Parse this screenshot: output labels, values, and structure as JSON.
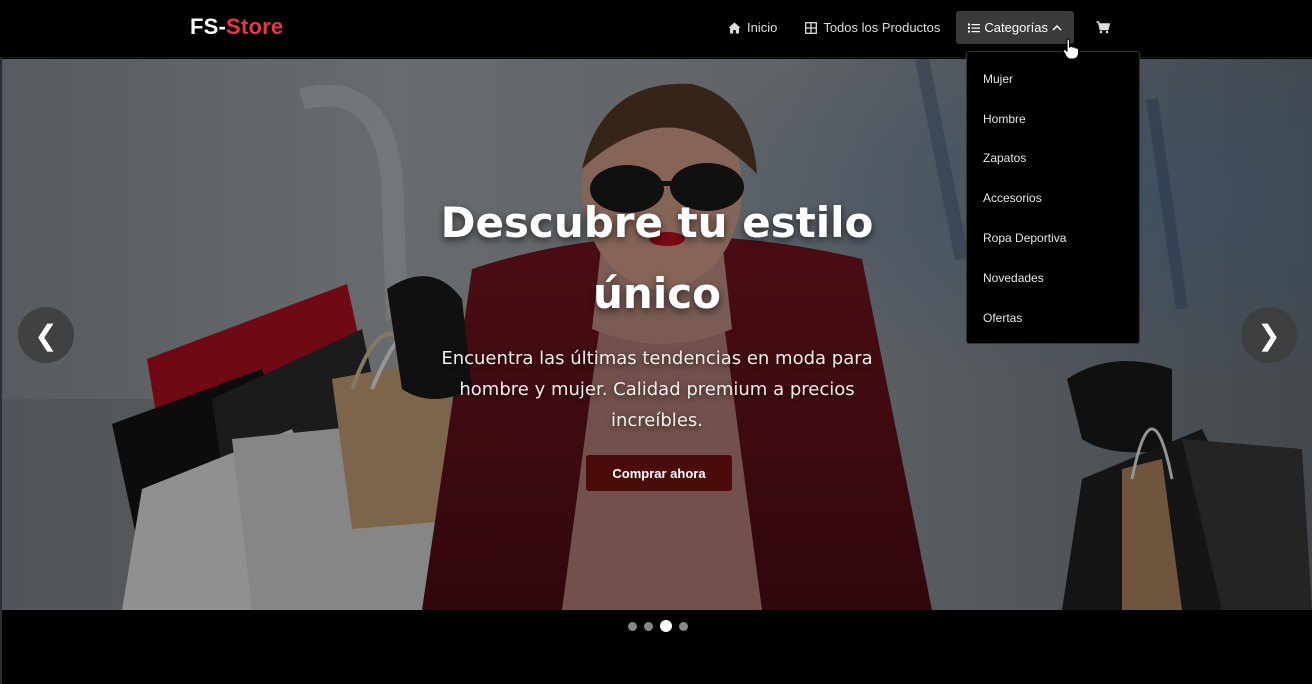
{
  "brand": {
    "part1": "FS-",
    "part2": "Store"
  },
  "nav": {
    "home": {
      "label": "Inicio",
      "icon": "home-icon"
    },
    "products": {
      "label": "Todos los Productos",
      "icon": "grid-icon"
    },
    "categories": {
      "label": "Categorías",
      "icon": "list-icon",
      "state": "open"
    },
    "cart": {
      "icon": "cart-icon"
    }
  },
  "dropdown": {
    "items": [
      "Mujer",
      "Hombre",
      "Zapatos",
      "Accesorios",
      "Ropa Deportiva",
      "Novedades",
      "Ofertas"
    ]
  },
  "hero": {
    "title_line1": "Descubre tu estilo",
    "title_line2": "único",
    "subtitle": "Encuentra las últimas tendencias en moda para hombre y mujer. Calidad premium a precios increíbles.",
    "cta_label": "Comprar ahora",
    "prev_label": "❮",
    "next_label": "❯"
  },
  "carousel": {
    "slides": 4,
    "active_index": 2
  },
  "colors": {
    "brand_accent": "#e63946",
    "cta_bg": "#4a0b0b",
    "nav_active_bg": "#3a3a3a"
  }
}
